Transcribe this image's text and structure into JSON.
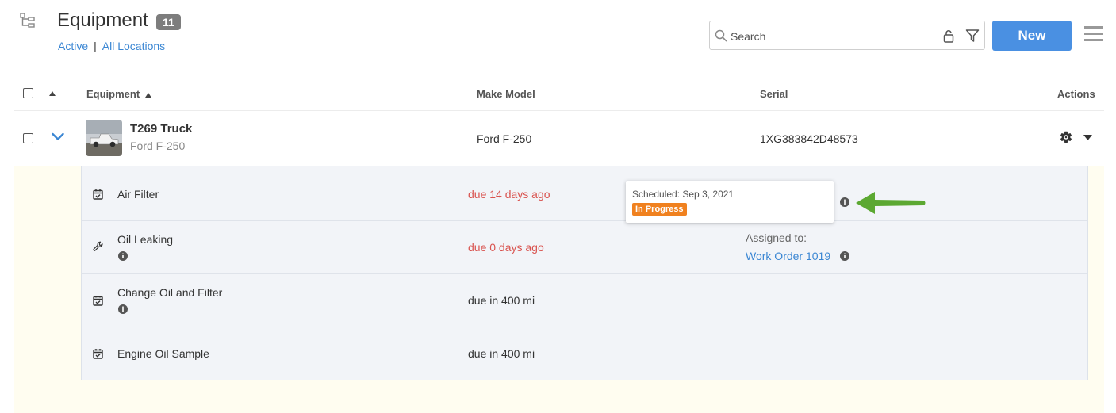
{
  "header": {
    "title": "Equipment",
    "count": "11",
    "filter_status": "Active",
    "filter_location": "All Locations",
    "separator": "|"
  },
  "search": {
    "placeholder": "Search"
  },
  "toolbar": {
    "new_label": "New"
  },
  "table": {
    "columns": {
      "equipment": "Equipment",
      "make_model": "Make Model",
      "serial": "Serial",
      "actions": "Actions"
    },
    "row": {
      "name": "T269 Truck",
      "subtitle": "Ford F-250",
      "make_model": "Ford F-250",
      "serial": "1XG383842D48573"
    }
  },
  "tasks": [
    {
      "name": "Air Filter",
      "due": "due 14 days ago",
      "icon": "calendar-check-icon",
      "overdue": true
    },
    {
      "name": "Oil Leaking",
      "due": "due 0 days ago",
      "icon": "wrench-icon",
      "overdue": true,
      "assigned_label": "Assigned to:",
      "work_order": "Work Order 1019"
    },
    {
      "name": "Change Oil and Filter",
      "due": "due in 400 mi",
      "icon": "calendar-check-icon",
      "overdue": false
    },
    {
      "name": "Engine Oil Sample",
      "due": "due in 400 mi",
      "icon": "calendar-check-icon",
      "overdue": false
    }
  ],
  "tooltip": {
    "scheduled": "Scheduled: Sep 3, 2021",
    "status": "In Progress"
  },
  "colors": {
    "accent": "#4a90e2",
    "overdue": "#d9534f",
    "in_progress": "#f0811f",
    "arrow": "#5ca832",
    "expand_bg": "#fffdf0"
  }
}
